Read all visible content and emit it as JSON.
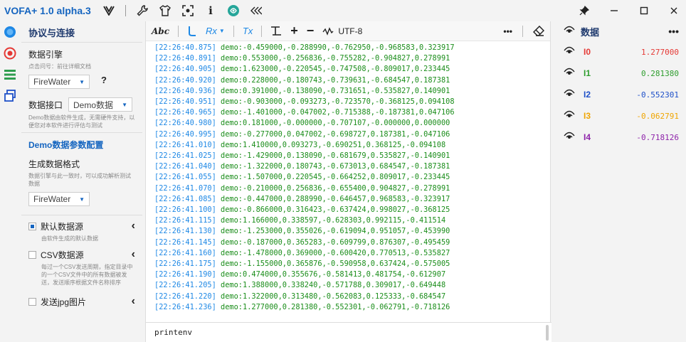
{
  "app": {
    "title": "VOFA+ 1.0 alpha.3"
  },
  "left_panel": {
    "title": "协议与连接",
    "engine": {
      "label": "数据引擎",
      "hint": "点击问号：前往详细文档",
      "value": "FireWater"
    },
    "interface": {
      "label": "数据接口",
      "value": "Demo数据",
      "hint": "Demo数据由软件生成，无需硬件支持，以便您对本软件进行评估与测试"
    },
    "demo_config": {
      "title": "Demo数据参数配置",
      "format_label": "生成数据格式",
      "format_hint": "数据引擎与此一致时，可以成功解析测试数据",
      "format_value": "FireWater"
    },
    "sources": [
      {
        "label": "默认数据源",
        "desc": "由软件生成的默认数据",
        "checked": true
      },
      {
        "label": "CSV数据源",
        "desc": "每过一个CSV发送周期，指定目录中的一个CSV文件中的所有数据被发送，发送顺序根据文件名称排序",
        "checked": false
      },
      {
        "label": "发送jpg图片",
        "desc": "",
        "checked": false
      }
    ]
  },
  "toolbar": {
    "abc": "Abc",
    "rx": "Rx",
    "tx": "Tx",
    "encoding": "UTF-8",
    "more": "•••"
  },
  "console": {
    "lines": [
      {
        "ts": "[22:26:40.875]",
        "msg": " demo:-0.459000,-0.288990,-0.762950,-0.968583,0.323917"
      },
      {
        "ts": "[22:26:40.891]",
        "msg": " demo:0.553000,-0.256836,-0.755282,-0.904827,0.278991"
      },
      {
        "ts": "[22:26:40.905]",
        "msg": " demo:1.623000,-0.220545,-0.747508,-0.809017,0.233445"
      },
      {
        "ts": "[22:26:40.920]",
        "msg": " demo:0.228000,-0.180743,-0.739631,-0.684547,0.187381"
      },
      {
        "ts": "[22:26:40.936]",
        "msg": " demo:0.391000,-0.138090,-0.731651,-0.535827,0.140901"
      },
      {
        "ts": "[22:26:40.951]",
        "msg": " demo:-0.903000,-0.093273,-0.723570,-0.368125,0.094108"
      },
      {
        "ts": "[22:26:40.965]",
        "msg": " demo:-1.401000,-0.047002,-0.715388,-0.187381,0.047106"
      },
      {
        "ts": "[22:26:40.980]",
        "msg": " demo:0.181000,-0.000000,-0.707107,-0.000000,0.000000"
      },
      {
        "ts": "[22:26:40.995]",
        "msg": " demo:-0.277000,0.047002,-0.698727,0.187381,-0.047106"
      },
      {
        "ts": "[22:26:41.010]",
        "msg": " demo:1.410000,0.093273,-0.690251,0.368125,-0.094108"
      },
      {
        "ts": "[22:26:41.025]",
        "msg": " demo:-1.429000,0.138090,-0.681679,0.535827,-0.140901"
      },
      {
        "ts": "[22:26:41.040]",
        "msg": " demo:-1.322000,0.180743,-0.673013,0.684547,-0.187381"
      },
      {
        "ts": "[22:26:41.055]",
        "msg": " demo:-1.507000,0.220545,-0.664252,0.809017,-0.233445"
      },
      {
        "ts": "[22:26:41.070]",
        "msg": " demo:-0.210000,0.256836,-0.655400,0.904827,-0.278991"
      },
      {
        "ts": "[22:26:41.085]",
        "msg": " demo:-0.447000,0.288990,-0.646457,0.968583,-0.323917"
      },
      {
        "ts": "[22:26:41.100]",
        "msg": " demo:-0.866000,0.316423,-0.637424,0.998027,-0.368125"
      },
      {
        "ts": "[22:26:41.115]",
        "msg": " demo:1.166000,0.338597,-0.628303,0.992115,-0.411514"
      },
      {
        "ts": "[22:26:41.130]",
        "msg": " demo:-1.253000,0.355026,-0.619094,0.951057,-0.453990"
      },
      {
        "ts": "[22:26:41.145]",
        "msg": " demo:-0.187000,0.365283,-0.609799,0.876307,-0.495459"
      },
      {
        "ts": "[22:26:41.160]",
        "msg": " demo:-1.478000,0.369000,-0.600420,0.770513,-0.535827"
      },
      {
        "ts": "[22:26:41.175]",
        "msg": " demo:-1.155000,0.365876,-0.590958,0.637424,-0.575005"
      },
      {
        "ts": "[22:26:41.190]",
        "msg": " demo:0.474000,0.355676,-0.581413,0.481754,-0.612907"
      },
      {
        "ts": "[22:26:41.205]",
        "msg": " demo:1.388000,0.338240,-0.571788,0.309017,-0.649448"
      },
      {
        "ts": "[22:26:41.220]",
        "msg": " demo:1.322000,0.313480,-0.562083,0.125333,-0.684547"
      },
      {
        "ts": "[22:26:41.236]",
        "msg": " demo:1.277000,0.281380,-0.552301,-0.062791,-0.718126"
      }
    ],
    "input_value": "printenv"
  },
  "right_panel": {
    "title": "数据",
    "channels": [
      {
        "name": "I0",
        "value": "1.277000",
        "color": "#e53935"
      },
      {
        "name": "I1",
        "value": "0.281380",
        "color": "#2e9d2e"
      },
      {
        "name": "I2",
        "value": "-0.552301",
        "color": "#1e50c8"
      },
      {
        "name": "I3",
        "value": "-0.062791",
        "color": "#f0a500"
      },
      {
        "name": "I4",
        "value": "-0.718126",
        "color": "#8e24aa"
      }
    ]
  },
  "icons": {
    "titlebar": [
      "vofa-logo-icon",
      "wrench-icon",
      "tshirt-icon",
      "scan-icon",
      "info-icon",
      "brain-icon",
      "collapse-icon"
    ],
    "window": [
      "pin-icon",
      "minimize-icon",
      "maximize-icon",
      "close-icon"
    ],
    "rail": [
      "connection-icon",
      "record-icon",
      "list-icon",
      "windows-icon"
    ]
  }
}
